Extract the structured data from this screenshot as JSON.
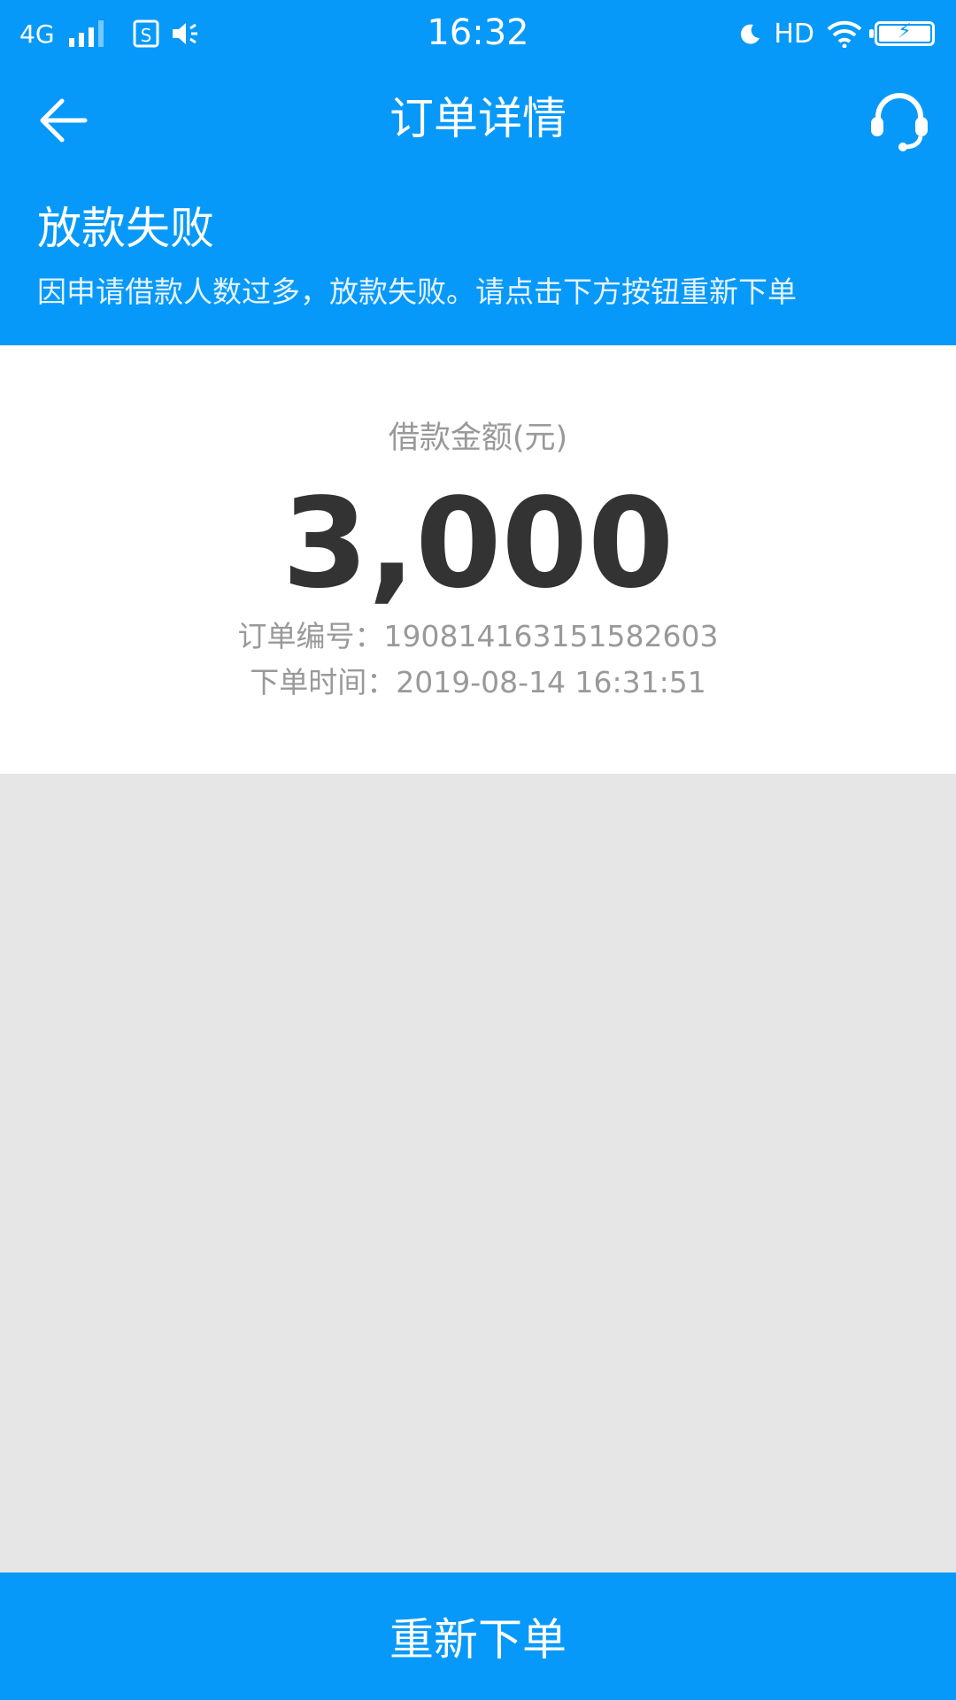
{
  "status_bar": {
    "network": "4G",
    "time": "16:32",
    "hd": "HD"
  },
  "nav": {
    "title": "订单详情"
  },
  "status": {
    "title": "放款失败",
    "description": "因申请借款人数过多，放款失败。请点击下方按钮重新下单"
  },
  "amount": {
    "label": "借款金额(元)",
    "value": "3,000"
  },
  "order": {
    "number_label": "订单编号：",
    "number": "190814163151582603",
    "time_label": "下单时间：",
    "time": "2019-08-14 16:31:51"
  },
  "action": {
    "reorder_label": "重新下单"
  },
  "colors": {
    "primary": "#0699f9",
    "background": "#e6e6e6",
    "amount_text": "#333333",
    "secondary_text": "#999999"
  }
}
